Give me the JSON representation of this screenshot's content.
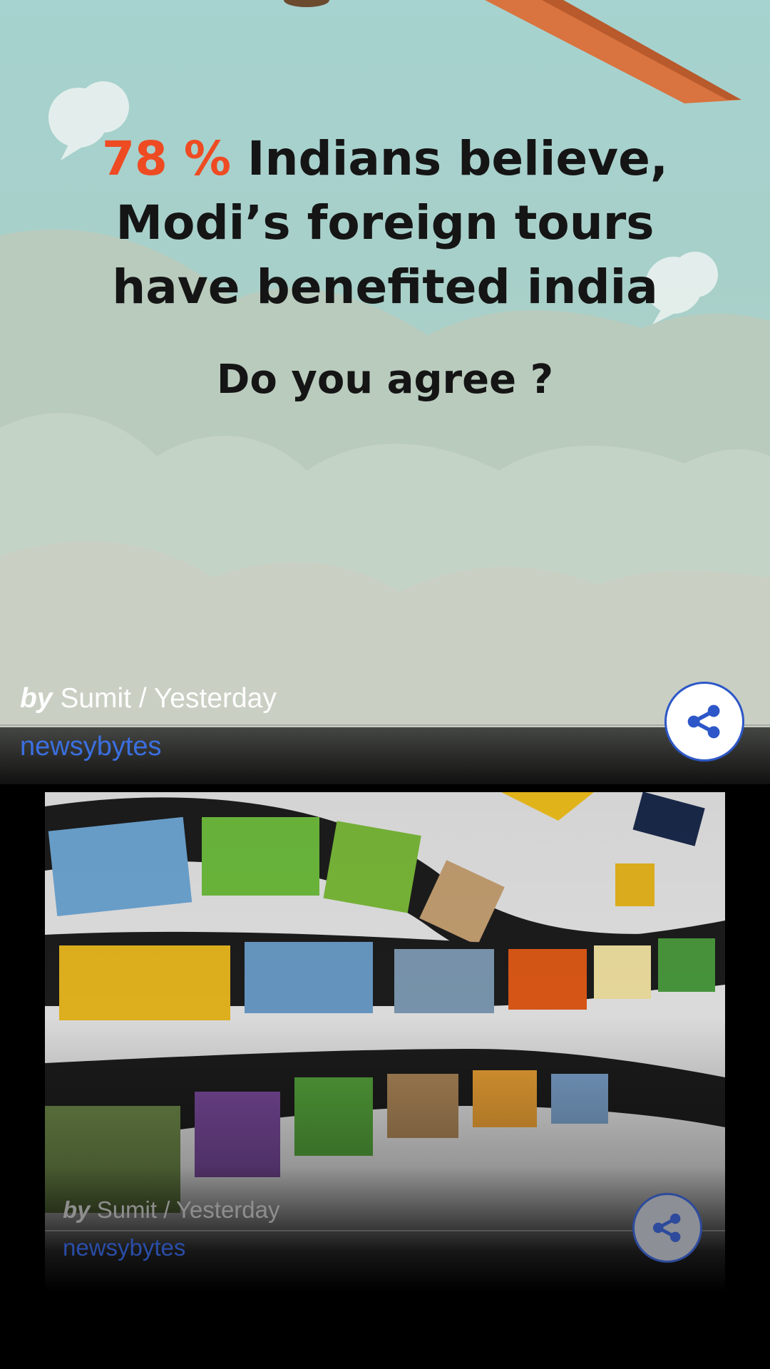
{
  "feed": {
    "cards": [
      {
        "headline_percent": "78 %",
        "headline_line1_rest": " Indians believe,",
        "headline_line2": "Modi’s foreign tours",
        "headline_line3": "have benefited india",
        "question": "Do you agree ?",
        "byline_prefix": "by",
        "byline_author_time": "Sumit / Yesterday",
        "source": "newsybytes",
        "share_icon": "share-icon"
      },
      {
        "byline_prefix": "by",
        "byline_author_time": "Sumit / Yesterday",
        "source": "newsybytes",
        "share_icon": "share-icon"
      }
    ]
  },
  "colors": {
    "headline_accent": "#ee4b23",
    "source_link": "#3b6fe0",
    "share_border": "#2d57c8"
  }
}
